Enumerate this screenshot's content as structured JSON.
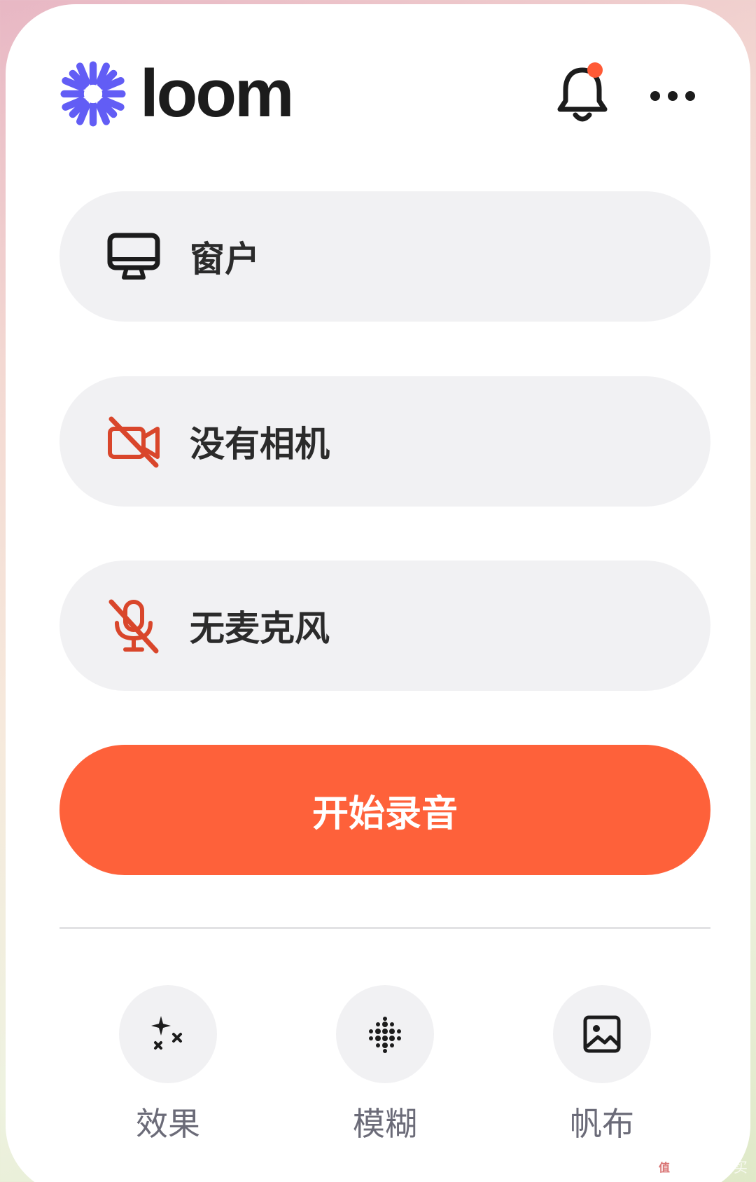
{
  "header": {
    "logo_text": "loom",
    "notification_badge_color": "#ff5a36",
    "brand_color": "#625df5"
  },
  "sources": {
    "screen_label": "窗户",
    "camera_label": "没有相机",
    "microphone_label": "无麦克风"
  },
  "record": {
    "label": "开始录音",
    "color": "#fe613a"
  },
  "tools": [
    {
      "label": "效果",
      "icon": "sparkles-icon"
    },
    {
      "label": "模糊",
      "icon": "blur-grid-icon"
    },
    {
      "label": "帆布",
      "icon": "image-icon"
    }
  ],
  "watermark": {
    "text": "什么值得买",
    "badge": "值"
  }
}
